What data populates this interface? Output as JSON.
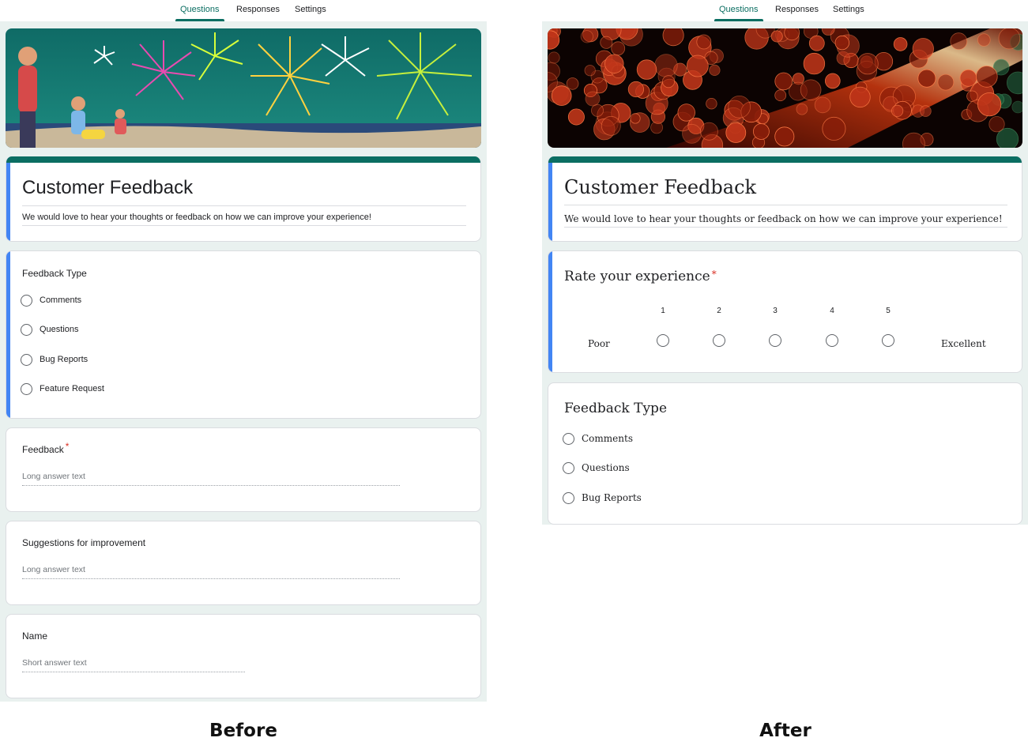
{
  "before": {
    "tabs": [
      {
        "label": "Questions",
        "active": true
      },
      {
        "label": "Responses",
        "active": false
      },
      {
        "label": "Settings",
        "active": false
      }
    ],
    "header_image": "fireworks-banner-image",
    "form": {
      "title": "Customer Feedback",
      "description": "We would love to hear your thoughts or feedback on how we can improve your experience!"
    },
    "questions": [
      {
        "title": "Feedback Type",
        "type": "multiple-choice",
        "options": [
          "Comments",
          "Questions",
          "Bug Reports",
          "Feature Request"
        ]
      },
      {
        "title": "Feedback",
        "required": "*",
        "type": "paragraph",
        "hint": "Long answer text"
      },
      {
        "title": "Suggestions for improvement",
        "type": "paragraph",
        "hint": "Long answer text"
      },
      {
        "title": "Name",
        "type": "short",
        "hint": "Short answer text"
      }
    ],
    "caption": "Before"
  },
  "after": {
    "tabs": [
      {
        "label": "Questions",
        "active": true
      },
      {
        "label": "Responses",
        "active": false
      },
      {
        "label": "Settings",
        "active": false
      }
    ],
    "header_image": "red-bokeh-lights-banner-image",
    "form": {
      "title": "Customer Feedback",
      "description": "We would love to hear your thoughts or feedback on how we can improve your experience!"
    },
    "rating": {
      "title": "Rate your experience",
      "required": "*",
      "scale": [
        "1",
        "2",
        "3",
        "4",
        "5"
      ],
      "low_label": "Poor",
      "high_label": "Excellent"
    },
    "questions": [
      {
        "title": "Feedback Type",
        "type": "multiple-choice",
        "options": [
          "Comments",
          "Questions",
          "Bug Reports"
        ]
      }
    ],
    "caption": "After"
  },
  "colors": {
    "theme": "#0b6e62",
    "canvas": "#e9f1ef",
    "focus": "#4285f4",
    "required": "#d93025"
  }
}
